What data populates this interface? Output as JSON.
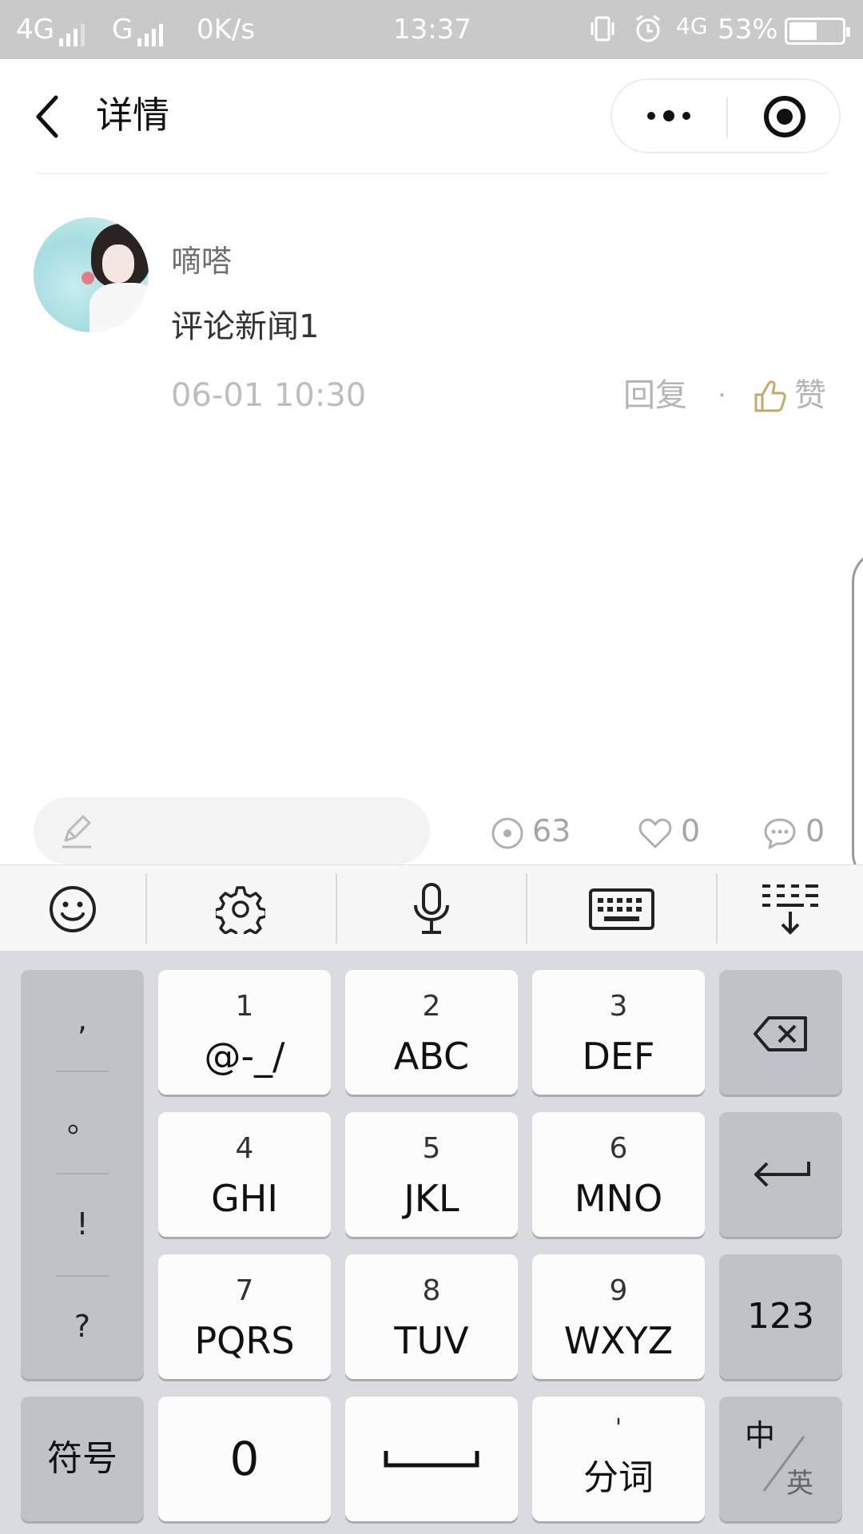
{
  "status_bar": {
    "sim1": "4G",
    "sim2": "G",
    "speed": "0K/s",
    "time": "13:37",
    "net_right": "4G",
    "battery": "53%",
    "battery_level": 0.53,
    "text_color": "#ffffff",
    "bg_color": "#c9c9c9"
  },
  "nav": {
    "title": "详情",
    "back_icon": "chevron-left-icon",
    "more_icon": "more-dots-icon",
    "close_icon": "target-circle-icon"
  },
  "comment": {
    "user_name": "嘀嗒",
    "text": "评论新闻1",
    "time": "06-01 10:30",
    "reply_label": "回复",
    "separator": "·",
    "like_label": "赞"
  },
  "bottom_bar": {
    "edit_icon": "pencil-icon",
    "views": "63",
    "likes": "0",
    "comments": "0"
  },
  "keyboard_toolbar": {
    "items": [
      "emoji-icon",
      "settings-gear-icon",
      "microphone-icon",
      "keyboard-icon",
      "hide-keyboard-icon"
    ]
  },
  "keyboard": {
    "punctuation": [
      ",",
      "。",
      "!",
      "?"
    ],
    "keys": [
      {
        "num": "1",
        "label": "@-_/"
      },
      {
        "num": "2",
        "label": "ABC"
      },
      {
        "num": "3",
        "label": "DEF"
      },
      {
        "num": "4",
        "label": "GHI"
      },
      {
        "num": "5",
        "label": "JKL"
      },
      {
        "num": "6",
        "label": "MNO"
      },
      {
        "num": "7",
        "label": "PQRS"
      },
      {
        "num": "8",
        "label": "TUV"
      },
      {
        "num": "9",
        "label": "WXYZ"
      }
    ],
    "numeric_label": "123",
    "symbol_label": "符号",
    "zero_label": "0",
    "split_mark": "'",
    "split_label": "分词",
    "lang_zh": "中",
    "lang_en": "英"
  }
}
